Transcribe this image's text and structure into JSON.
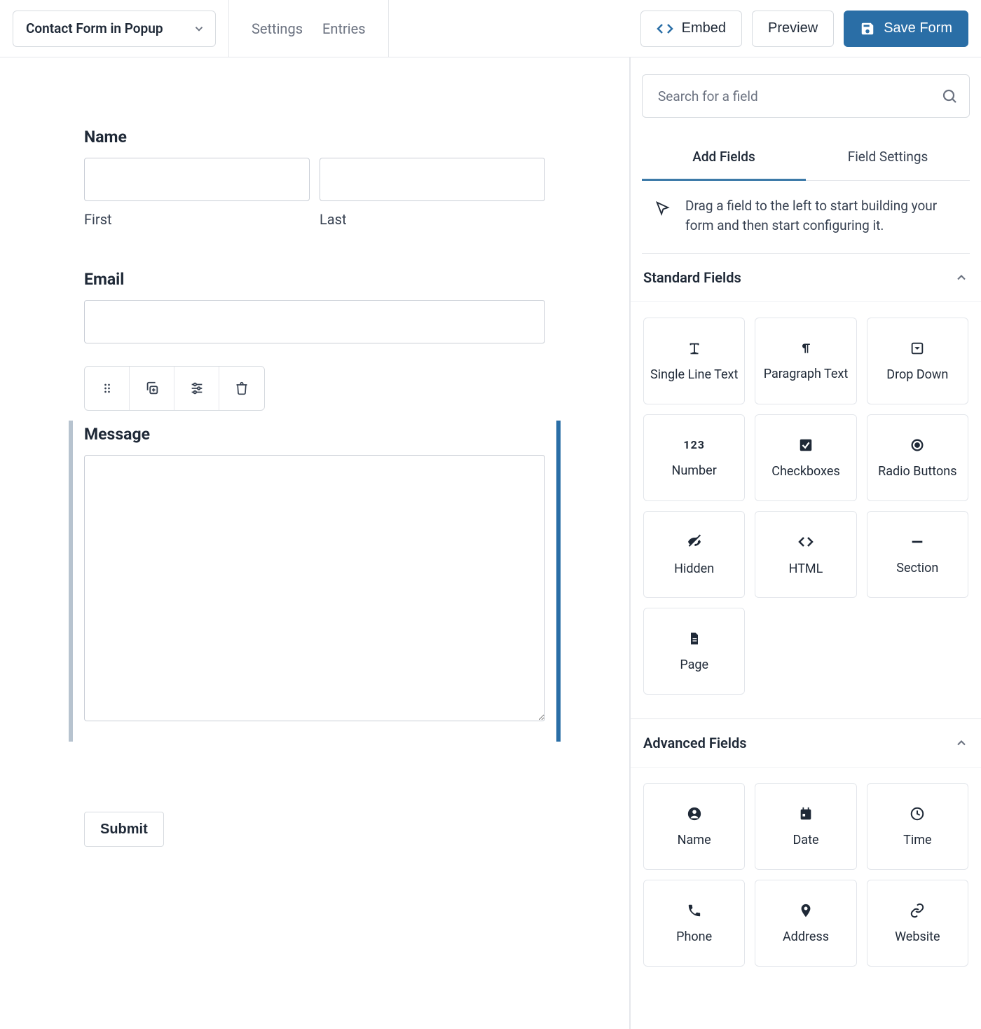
{
  "header": {
    "form_name": "Contact Form in Popup",
    "nav_settings": "Settings",
    "nav_entries": "Entries",
    "embed_label": "Embed",
    "preview_label": "Preview",
    "save_label": "Save Form"
  },
  "form": {
    "name_label": "Name",
    "first_sublabel": "First",
    "last_sublabel": "Last",
    "email_label": "Email",
    "message_label": "Message",
    "submit_label": "Submit"
  },
  "panel": {
    "search_placeholder": "Search for a field",
    "tab_add": "Add Fields",
    "tab_settings": "Field Settings",
    "hint_text": "Drag a field to the left to start building your form and then start configuring it.",
    "section_standard": "Standard Fields",
    "section_advanced": "Advanced Fields",
    "standard": [
      {
        "label": "Single Line Text",
        "icon": "text"
      },
      {
        "label": "Paragraph Text",
        "icon": "paragraph"
      },
      {
        "label": "Drop Down",
        "icon": "dropdown"
      },
      {
        "label": "Number",
        "icon": "number"
      },
      {
        "label": "Checkboxes",
        "icon": "checkbox"
      },
      {
        "label": "Radio Buttons",
        "icon": "radio"
      },
      {
        "label": "Hidden",
        "icon": "hidden"
      },
      {
        "label": "HTML",
        "icon": "html"
      },
      {
        "label": "Section",
        "icon": "section"
      },
      {
        "label": "Page",
        "icon": "page"
      }
    ],
    "advanced": [
      {
        "label": "Name",
        "icon": "name"
      },
      {
        "label": "Date",
        "icon": "date"
      },
      {
        "label": "Time",
        "icon": "time"
      },
      {
        "label": "Phone",
        "icon": "phone"
      },
      {
        "label": "Address",
        "icon": "address"
      },
      {
        "label": "Website",
        "icon": "website"
      }
    ]
  }
}
